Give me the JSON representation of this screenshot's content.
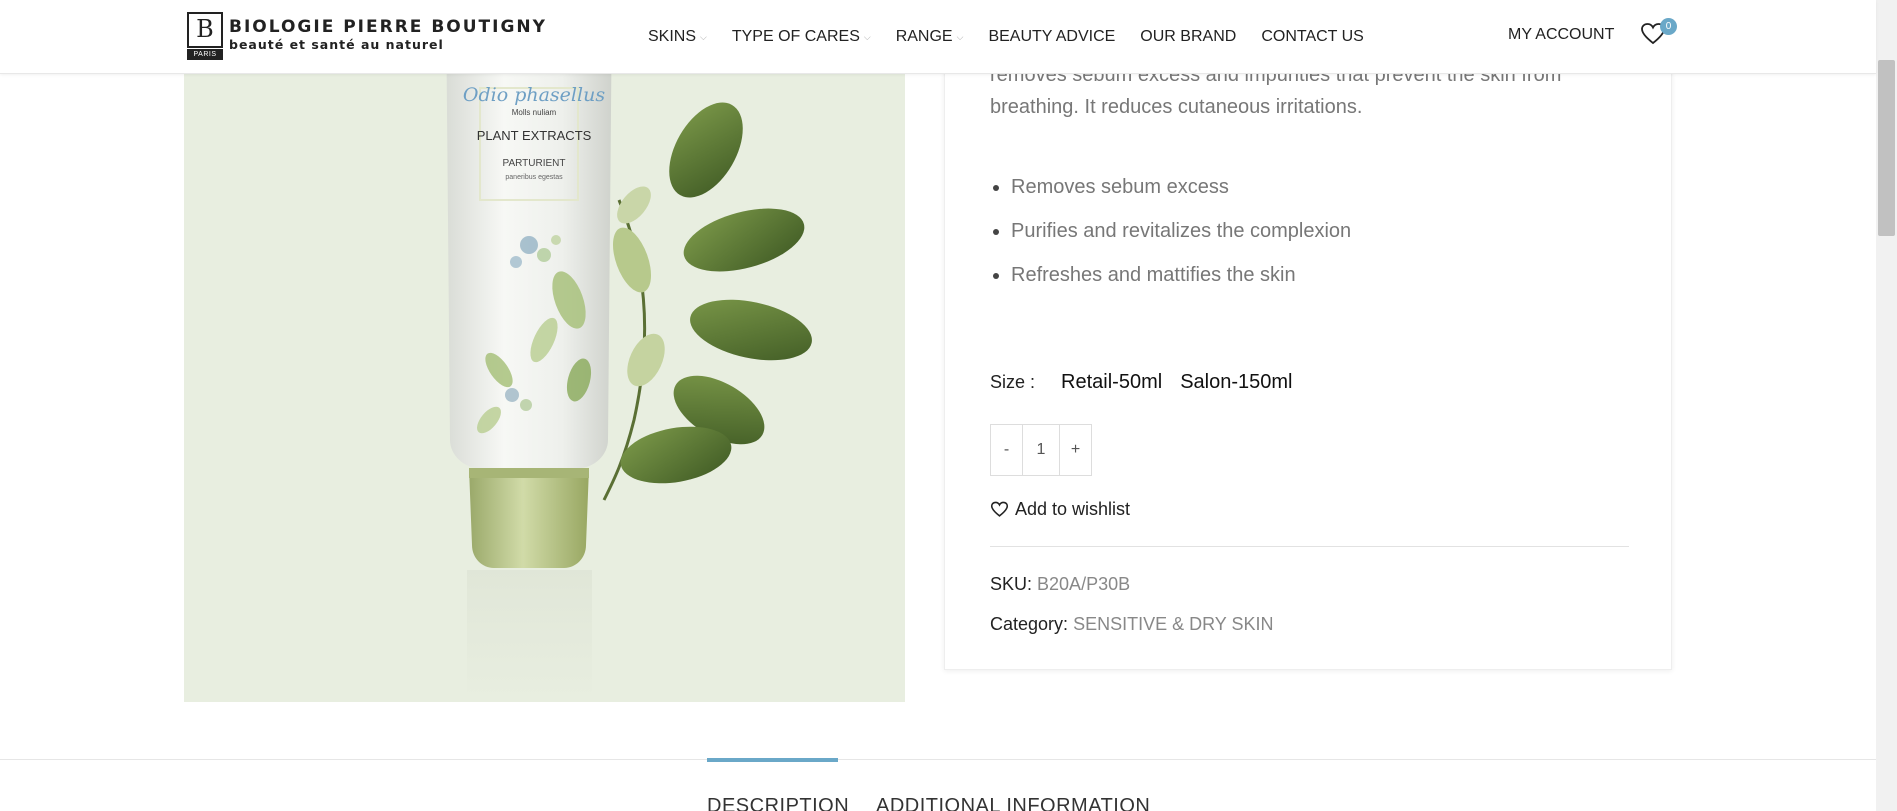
{
  "header": {
    "logo_title": "BIOLOGIE PIERRE BOUTIGNY",
    "logo_subtitle": "beauté et santé au naturel",
    "logo_badge": "PARIS",
    "nav": [
      {
        "label": "SKINS"
      },
      {
        "label": "TYPE OF CARES"
      },
      {
        "label": "RANGE"
      },
      {
        "label": "BEAUTY ADVICE"
      },
      {
        "label": "OUR BRAND"
      },
      {
        "label": "CONTACT US"
      }
    ],
    "account_label": "MY ACCOUNT",
    "wishlist_count": "0"
  },
  "product_image": {
    "script_text": "Odio phasellus",
    "small_line": "Molls nuliam",
    "title": "PLANT EXTRACTS",
    "subtitle": "PARTURIENT",
    "tiny": "paneribus egestas"
  },
  "summary": {
    "description": "removes sebum excess and impurities that prevent the skin from breathing. It reduces cutaneous irritations.",
    "bullets": [
      "Removes sebum excess",
      "Purifies and revitalizes the complexion",
      "Refreshes and mattifies the skin"
    ],
    "size_label": "Size :",
    "size_options": [
      "Retail-50ml",
      "Salon-150ml"
    ],
    "qty_minus": "-",
    "qty_value": "1",
    "qty_plus": "+",
    "add_to_wishlist": "Add to wishlist",
    "sku_label": "SKU:",
    "sku_value": "B20A/P30B",
    "category_label": "Category:",
    "category_value": "SENSITIVE & DRY SKIN"
  },
  "tabs": [
    "DESCRIPTION",
    "ADDITIONAL INFORMATION"
  ],
  "colors": {
    "accent": "#6aa8c8",
    "image_bg": "#e8eee0"
  }
}
